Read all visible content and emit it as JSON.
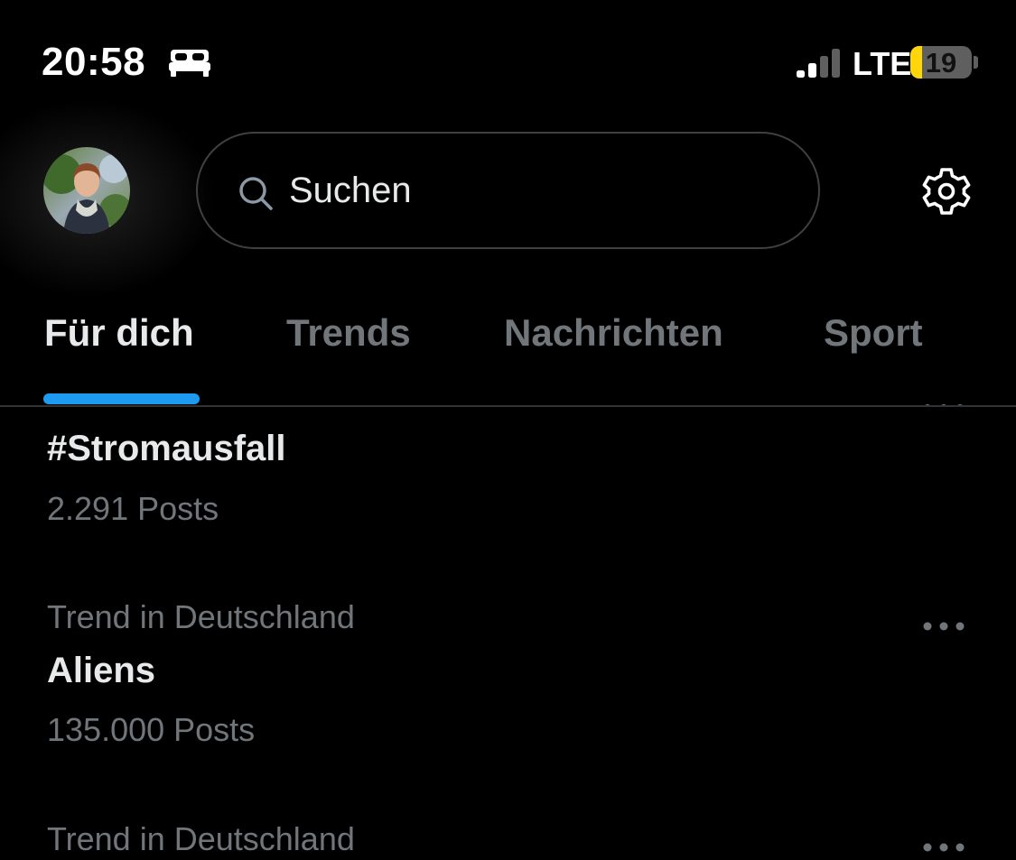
{
  "status_bar": {
    "time": "20:58",
    "carrier_network": "LTE",
    "battery_percent": 19,
    "battery_label": "19",
    "signal_bars_active": 2,
    "signal_bars_total": 4,
    "focus_icon": "bed-icon"
  },
  "header": {
    "search_placeholder": "Suchen",
    "settings_icon": "gear-icon",
    "search_icon": "search-icon"
  },
  "tabs": [
    {
      "label": "Für dich",
      "active": true
    },
    {
      "label": "Trends",
      "active": false
    },
    {
      "label": "Nachrichten",
      "active": false
    },
    {
      "label": "Sport",
      "active": false
    }
  ],
  "trends": [
    {
      "context": "",
      "name": "#Stromausfall",
      "posts": "2.291 Posts"
    },
    {
      "context": "Trend in Deutschland",
      "name": "Aliens",
      "posts": "135.000 Posts"
    },
    {
      "context": "Trend in Deutschland",
      "name": "",
      "posts": ""
    }
  ],
  "colors": {
    "background": "#000000",
    "accent": "#1d9bf0",
    "text_primary": "#e7e9ea",
    "text_secondary": "#71767b",
    "battery_low": "#ffd60a"
  }
}
